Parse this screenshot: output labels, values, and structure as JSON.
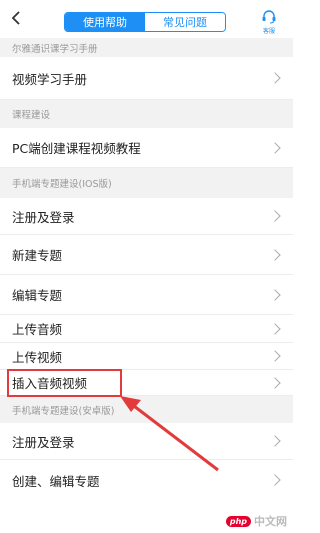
{
  "header": {
    "tabs": [
      {
        "label": "使用帮助",
        "active": true
      },
      {
        "label": "常见问题",
        "active": false
      }
    ],
    "service_label": "客服"
  },
  "sections": [
    "尔雅通识课学习手册",
    "课程建设",
    "手机端专题建设(IOS版)",
    "手机端专题建设(安卓版)"
  ],
  "items": [
    "视频学习手册",
    "PC端创建课程视频教程",
    "注册及登录",
    "新建专题",
    "编辑专题",
    "上传音频",
    "上传视频",
    "插入音频视频",
    "注册及登录",
    "创建、编辑专题"
  ],
  "watermark": {
    "logo": "php",
    "text": "中文网"
  },
  "colors": {
    "accent": "#1e90f5",
    "highlight": "#e33b3b"
  }
}
